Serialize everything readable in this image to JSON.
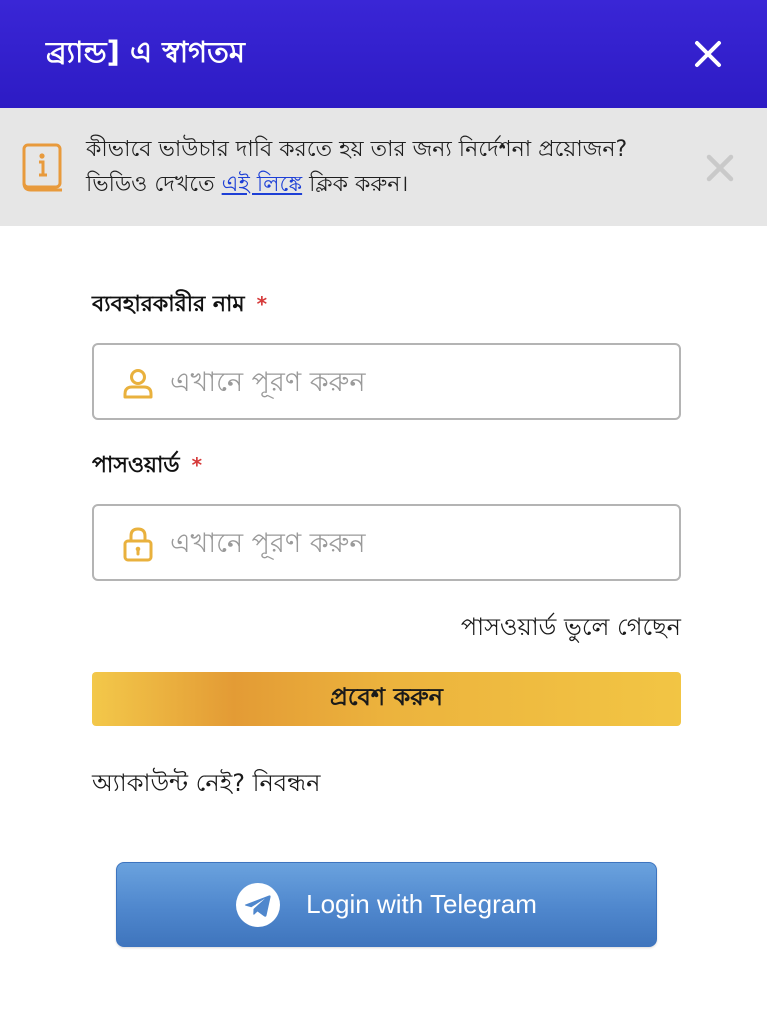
{
  "header": {
    "title": "ব্র্যান্ড] এ স্বাগতম",
    "close_icon": "close-icon",
    "background_color": "#3a26d6"
  },
  "notice": {
    "text_before_link": "কীভাবে ভাউচার দাবি করতে হয় তার জন্য নির্দেশনা প্রয়োজন? ভিডিও দেখতে ",
    "link_text": "এই লিঙ্কে",
    "text_after_link": " ক্লিক করুন।",
    "icon": "info-book-icon",
    "close_icon": "close-icon",
    "link_color": "#1d3fd6"
  },
  "form": {
    "username": {
      "label": "ব্যবহারকারীর নাম",
      "required_mark": "*",
      "placeholder": "এখানে পূরণ করুন",
      "value": "",
      "icon": "user-icon"
    },
    "password": {
      "label": "পাসওয়ার্ড",
      "required_mark": "*",
      "placeholder": "এখানে পূরণ করুন",
      "value": "",
      "icon": "lock-icon"
    },
    "forgot_password": "পাসওয়ার্ড ভুলে গেছেন",
    "login_button": "প্রবেশ করুন",
    "register_link": "অ্যাকাউন্ট নেই? নিবন্ধন"
  },
  "telegram": {
    "label": "Login with Telegram",
    "icon": "telegram-icon",
    "color": "#4f87cd"
  },
  "colors": {
    "accent_gold": "#ecb33d",
    "required_red": "#d63a3a",
    "icon_gold": "#e9b13d"
  }
}
